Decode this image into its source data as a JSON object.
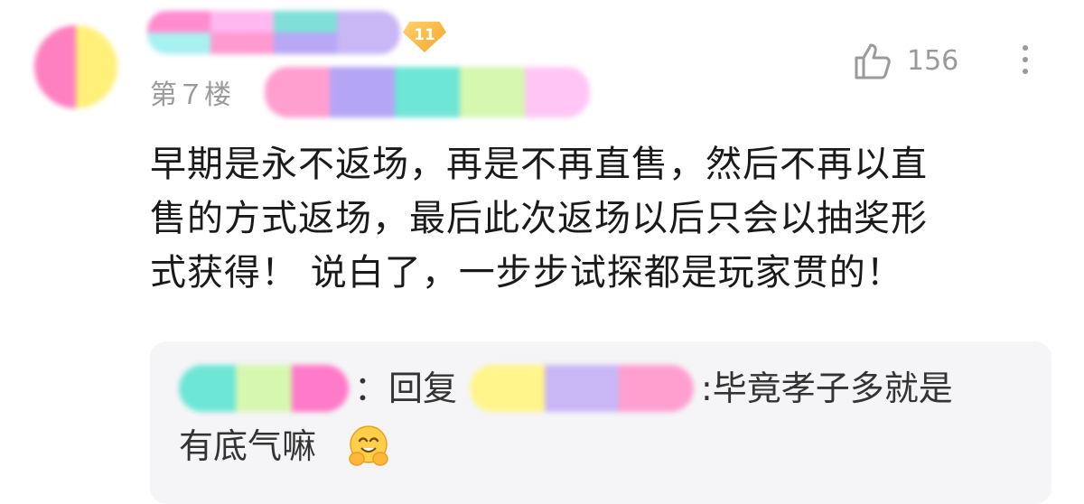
{
  "comment": {
    "floor_label": "第７楼",
    "level_badge": "11",
    "like_count": "156",
    "text_lines": [
      "早期是永不返场，再是不再直售，然后不再以直",
      "售的方式返场，最后此次返场以后只会以抽奖形",
      "式获得！ 说白了，一步步试探都是玩家贯的！"
    ]
  },
  "reply": {
    "colon_reply": "：回复",
    "text_line1": ":毕竟孝子多就是",
    "text_line2": "有底气嘛"
  },
  "icons": {
    "like": "thumbs-up-icon",
    "more": "vertical-ellipsis-icon",
    "emoji": "hugging-face-emoji-icon"
  },
  "colors": {
    "text_primary": "#1a1a1a",
    "text_secondary": "#9a9a9a",
    "reply_bg": "#f5f5f7",
    "badge": "#f4a52a"
  }
}
